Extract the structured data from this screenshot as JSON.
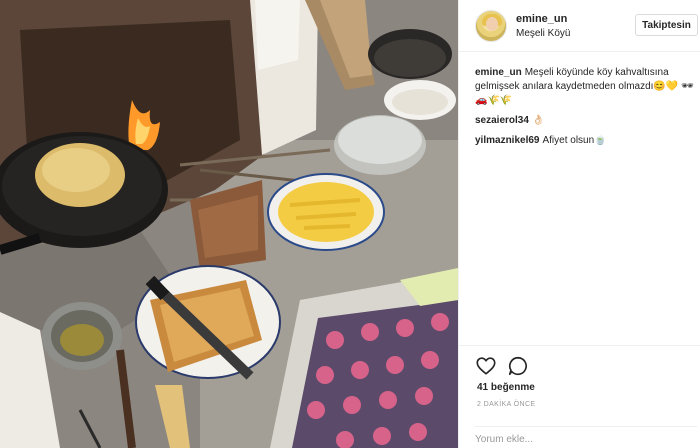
{
  "post": {
    "author": "emine_un",
    "location": "Meşeli Köyü",
    "follow_label": "Takiptesin"
  },
  "comments": [
    {
      "user": "emine_un",
      "text": "Meşeli köyünde köy kahvaltısına gelmişsek anılara kaydetmeden olmazdı😊💛 🕶🚗🌾🌾"
    },
    {
      "user": "sezaierol34",
      "text": "👌🏻"
    },
    {
      "user": "yilmaznikel69",
      "text": "Afiyet olsun🍵"
    }
  ],
  "actions": {
    "like_icon": "heart-icon",
    "comment_icon": "comment-icon",
    "likes_text": "41 beğenme",
    "time_text": "2 DAKİKA ÖNCE"
  },
  "comment_input": {
    "placeholder": "Yorum ekle..."
  },
  "photo": {
    "description_icon": "photo-of-village-breakfast",
    "colors": {
      "ground": "#8d8780",
      "oven": "#eae6de",
      "fire": "#ff8a1c",
      "pan": "#1a1a1a",
      "bread": "#d9b86a",
      "pasta": "#f6cf4a",
      "cloth": "#d86a8c"
    }
  }
}
